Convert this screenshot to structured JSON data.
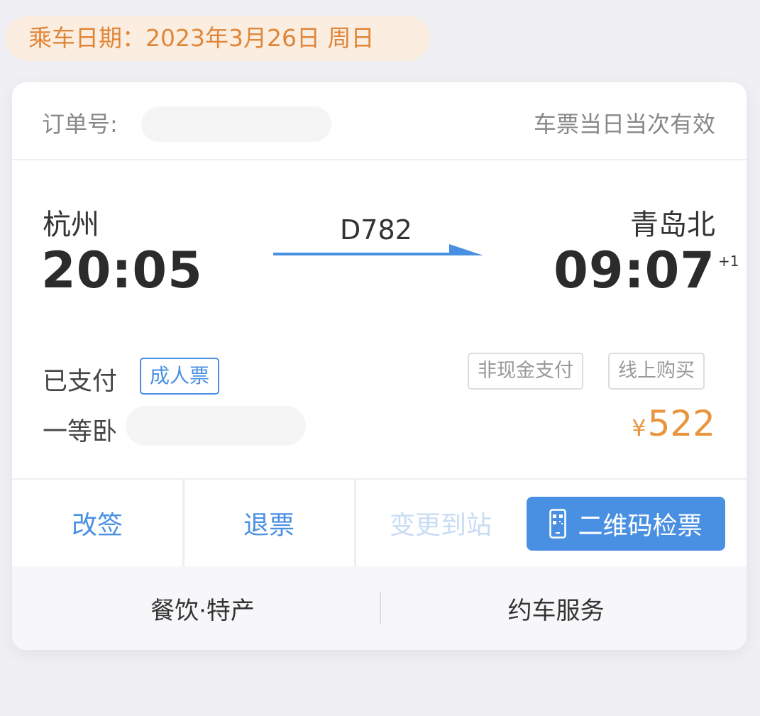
{
  "header": {
    "date_label": "乘车日期：2023年3月26日 周日"
  },
  "order": {
    "label": "订单号:",
    "validity": "车票当日当次有效"
  },
  "trip": {
    "from_city": "杭州",
    "from_time": "20:05",
    "train_no": "D782",
    "to_city": "青岛北",
    "to_time": "09:07",
    "next_day": "+1"
  },
  "ticket": {
    "status": "已支付",
    "type": "成人票",
    "tags": [
      "非现金支付",
      "线上购买"
    ],
    "seat_class": "一等卧",
    "currency": "¥",
    "price": "522"
  },
  "actions": {
    "change": "改签",
    "refund": "退票",
    "change_station": "变更到站",
    "qr_check": "二维码检票"
  },
  "services": {
    "food": "餐饮·特产",
    "car": "约车服务"
  },
  "icons": {
    "qr_button_icon": "phone-qr-icon",
    "route_arrow": "arrow-right-icon"
  },
  "colors": {
    "accent": "#4a90e2",
    "orange": "#e0863a",
    "price": "#e8963e",
    "disabled": "#c8dcf3"
  }
}
